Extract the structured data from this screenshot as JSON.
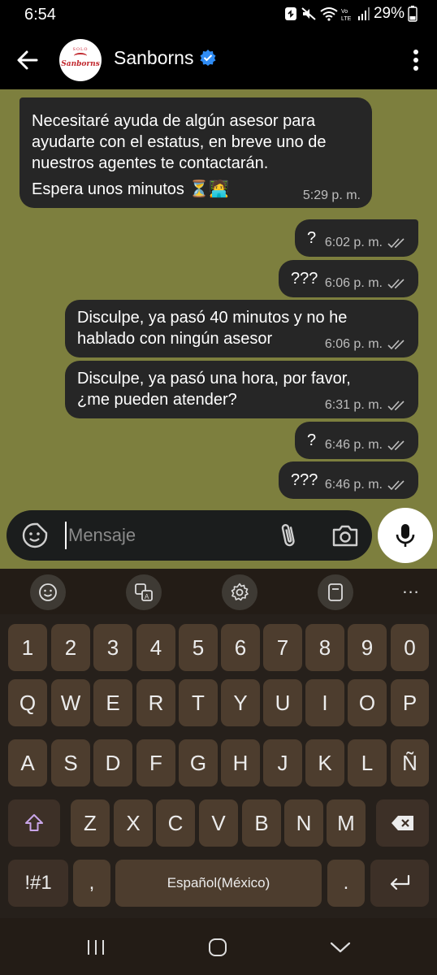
{
  "status": {
    "time": "6:54",
    "battery": "29%"
  },
  "header": {
    "name": "Sanborns",
    "avatar_small": "SOLO",
    "avatar_main": "Sanborns"
  },
  "messages": [
    {
      "lines": [
        "Necesitaré ayuda de algún asesor para",
        "ayudarte con el estatus, en breve uno de",
        "nuestros agentes te contactarán."
      ],
      "extra": "Espera unos minutos ⏳🧑‍💻",
      "time": "5:29 p. m.",
      "direction": "received"
    },
    {
      "text": "?",
      "time": "6:02 p. m.",
      "direction": "sent"
    },
    {
      "text": "???",
      "time": "6:06 p. m.",
      "direction": "sent"
    },
    {
      "lines": [
        "Disculpe, ya pasó 40 minutos y no he",
        "hablado con ningún asesor"
      ],
      "time": "6:06 p. m.",
      "direction": "sent"
    },
    {
      "lines": [
        "Disculpe, ya pasó una hora, por favor,",
        "¿me pueden atender?"
      ],
      "time": "6:31 p. m.",
      "direction": "sent"
    },
    {
      "text": "?",
      "time": "6:46 p. m.",
      "direction": "sent"
    },
    {
      "text": "???",
      "time": "6:46 p. m.",
      "direction": "sent"
    }
  ],
  "input": {
    "placeholder": "Mensaje"
  },
  "keyboard": {
    "numbers": [
      "1",
      "2",
      "3",
      "4",
      "5",
      "6",
      "7",
      "8",
      "9",
      "0"
    ],
    "row1": [
      "Q",
      "W",
      "E",
      "R",
      "T",
      "Y",
      "U",
      "I",
      "O",
      "P"
    ],
    "row2": [
      "A",
      "S",
      "D",
      "F",
      "G",
      "H",
      "J",
      "K",
      "L",
      "Ñ"
    ],
    "row3": [
      "Z",
      "X",
      "C",
      "V",
      "B",
      "N",
      "M"
    ],
    "symbols_key": "!#1",
    "comma_key": ",",
    "space_label": "Español(México)",
    "period_key": ".",
    "more_label": "..."
  },
  "colors": {
    "chat_bg": "#7d7f3e",
    "bubble": "#262626",
    "key": "#4d3d2e",
    "keyboard_bg": "#26201b",
    "verified": "#2f8cf5"
  }
}
